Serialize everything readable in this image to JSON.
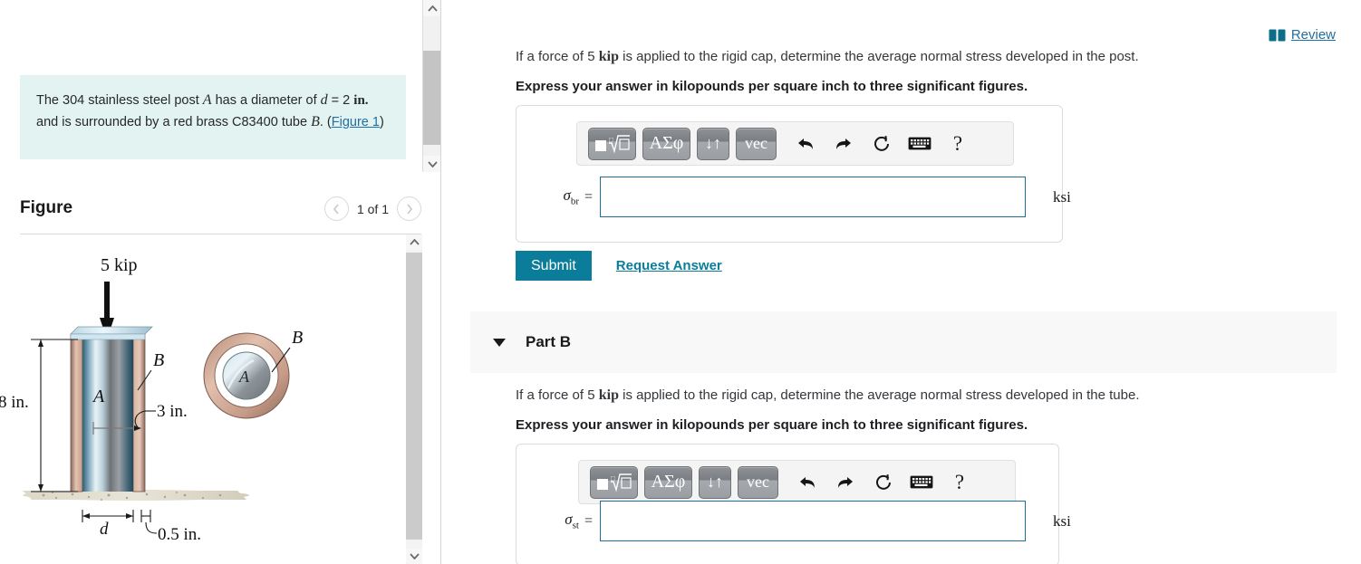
{
  "left": {
    "info_text_parts": {
      "p1": "The 304 stainless steel post ",
      "A": "A",
      "p2": " has a diameter of ",
      "d": "d",
      "p3": " = 2 ",
      "in": "in.",
      "p4": " and is surrounded by a red brass C83400 tube ",
      "B": "B",
      "p5": ". (",
      "figure_link": "Figure 1",
      "p6": ")"
    },
    "figure_title": "Figure",
    "figure_nav": {
      "prev_icon": "chevron-left-icon",
      "next_icon": "chevron-right-icon",
      "counter": "1 of 1"
    },
    "figure_labels": {
      "load": "5 kip",
      "height": "8 in.",
      "inner_label": "A",
      "outer_label": "B",
      "section_outer_label": "B",
      "section_inner_label": "A",
      "diameter_callout": "3 in.",
      "base_width": "d",
      "thickness": "0.5 in."
    }
  },
  "right": {
    "review": {
      "icon": "book-icon",
      "label": "Review"
    },
    "part_a": {
      "question": "If a force of 5 kip is applied to the rigid cap, determine the average normal stress developed in the post.",
      "question_pre": "If a force of 5 ",
      "question_kip": "kip",
      "question_post": " is applied to the rigid cap, determine the average normal stress developed in the post.",
      "instruction": "Express your answer in kilopounds per square inch to three significant figures.",
      "toolbar": {
        "sqrt_button": "template-math-icon",
        "greek_button": "ΑΣφ",
        "updown_button": "↓↑",
        "vec_button": "vec",
        "undo_icon": "undo-arrow-icon",
        "redo_icon": "redo-arrow-icon",
        "reset_icon": "reset-circular-arrow-icon",
        "keyboard_icon": "keyboard-icon",
        "help_label": "?"
      },
      "answer": {
        "symbol": "σ",
        "subscript": "br",
        "equals": "=",
        "value": "",
        "placeholder": "",
        "unit": "ksi"
      },
      "submit_label": "Submit",
      "request_answer_label": "Request Answer"
    },
    "part_b_header": {
      "caret_icon": "caret-down-icon",
      "label": "Part B"
    },
    "part_b": {
      "question_pre": "If a force of 5 ",
      "question_kip": "kip",
      "question_post": " is applied to the rigid cap, determine the average normal stress developed in the tube.",
      "instruction": "Express your answer in kilopounds per square inch to three significant figures.",
      "toolbar": {
        "sqrt_button": "template-math-icon",
        "greek_button": "ΑΣφ",
        "updown_button": "↓↑",
        "vec_button": "vec",
        "undo_icon": "undo-arrow-icon",
        "redo_icon": "redo-arrow-icon",
        "reset_icon": "reset-circular-arrow-icon",
        "keyboard_icon": "keyboard-icon",
        "help_label": "?"
      },
      "answer": {
        "symbol": "σ",
        "subscript": "st",
        "equals": "=",
        "value": "",
        "placeholder": "",
        "unit": "ksi"
      }
    }
  },
  "colors": {
    "info_bg": "#e3f3f2",
    "link": "#1f6fa5",
    "submit_bg": "#0b7c99",
    "input_border": "#1f6f94",
    "part_header_bg": "#f8f8f8"
  }
}
